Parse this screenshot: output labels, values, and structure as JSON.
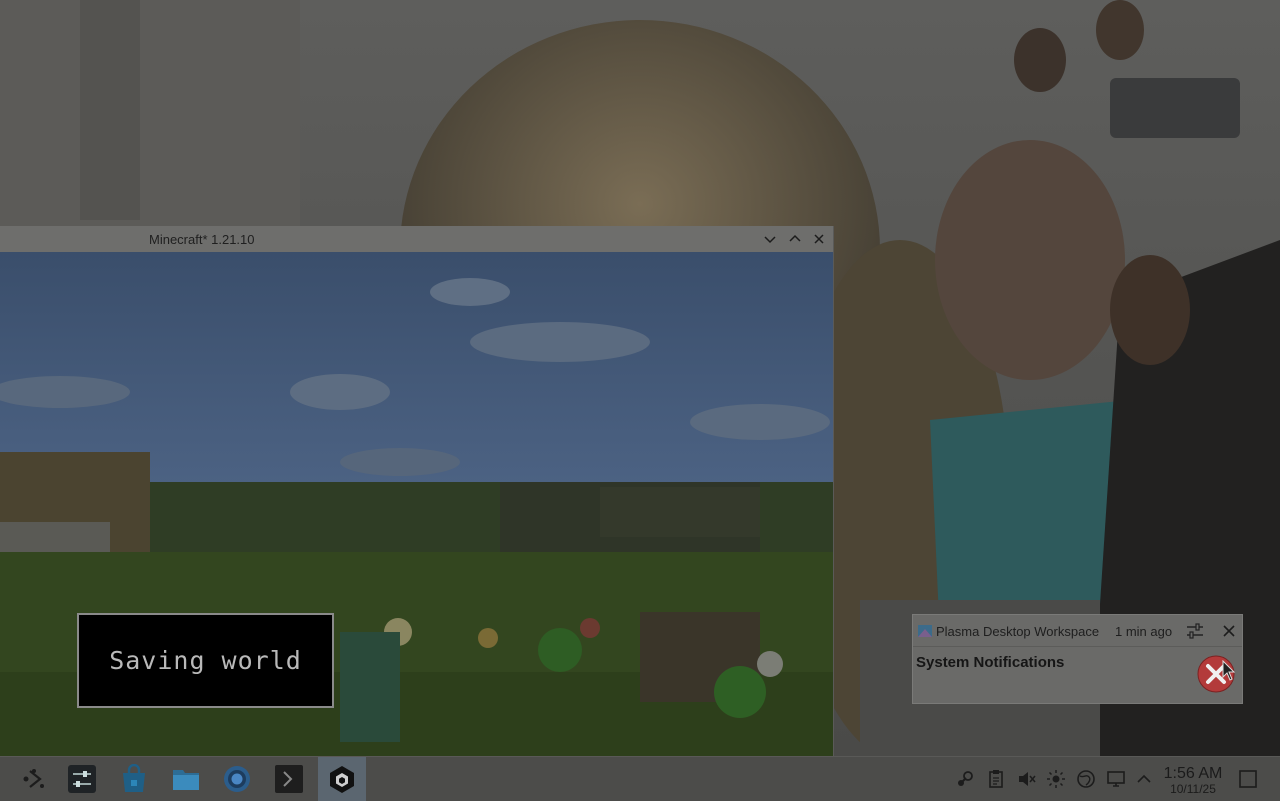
{
  "minecraft_window": {
    "title": "Minecraft* 1.21.10",
    "saving_text": "Saving world"
  },
  "notification": {
    "app_name": "Plasma Desktop Workspace",
    "time_ago": "1 min ago",
    "title": "System Notifications"
  },
  "taskbar": {
    "apps": [
      {
        "name": "application-launcher",
        "icon": "kde-launcher-icon"
      },
      {
        "name": "system-settings",
        "icon": "settings-sliders-icon"
      },
      {
        "name": "discover-store",
        "icon": "store-bag-icon"
      },
      {
        "name": "file-manager",
        "icon": "folder-icon"
      },
      {
        "name": "web-browser",
        "icon": "chromium-icon"
      },
      {
        "name": "terminal",
        "icon": "terminal-icon"
      },
      {
        "name": "minecraft",
        "icon": "minecraft-icon",
        "active": true
      }
    ],
    "tray_icons": [
      "steam-icon",
      "clipboard-icon",
      "volume-muted-icon",
      "brightness-icon",
      "network-globe-icon",
      "display-icon",
      "expand-tray-icon"
    ],
    "clock": {
      "time": "1:56 AM",
      "date": "10/11/25"
    }
  },
  "colors": {
    "taskbar_bg": "#4c4c4a",
    "active_task_bg": "#5b6670",
    "notification_bg": "#6a6a68",
    "error_red": "#b33a3a"
  }
}
